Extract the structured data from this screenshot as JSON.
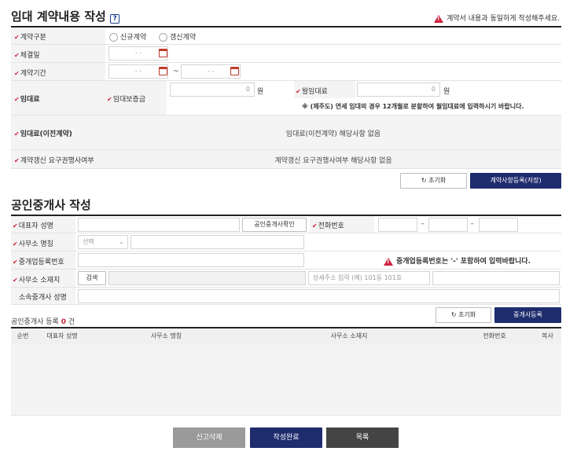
{
  "section1": {
    "title": "임대 계약내용 작성",
    "help_icon": "?",
    "warning": "계약서 내용과 동일하게 작성해주세요.",
    "contract_type": {
      "label": "계약구분",
      "options": [
        "신규계약",
        "갱신계약"
      ]
    },
    "sign_date": {
      "label": "체결일",
      "placeholder": "- -"
    },
    "period": {
      "label": "계약기간",
      "from_placeholder": "- -",
      "tilde": "~",
      "to_placeholder": "- -"
    },
    "rent": {
      "label": "임대료",
      "deposit_label": "임대보증금",
      "deposit_value": "0",
      "deposit_unit": "원",
      "monthly_label": "월임대료",
      "monthly_value": "0",
      "monthly_unit": "원",
      "note": "※ (제주도) 연세 임대의 경우 12개월로 분할하여 월임대료에 입력하시기 바랍니다."
    },
    "prev_rent": {
      "label": "임대료(이전계약)",
      "value": "임대료(이전계약) 해당사항 없음"
    },
    "renewal_right": {
      "label": "계약갱신 요구권행사여부",
      "value": "계약갱신 요구권행사여부 해당사항 없음"
    },
    "reset_button": "초기화",
    "save_button": "계약사항등록(저장)"
  },
  "section2": {
    "title": "공인중개사 작성",
    "rep_name_label": "대표자 성명",
    "verify_button": "공인중개사확인",
    "phone_label": "전화번호",
    "phone_dash": "-",
    "office_name_label": "사무소 명칭",
    "office_select": "선택",
    "reg_no_label": "중개업등록번호",
    "reg_warning": "중개업등록번호는 '-' 포함하여 입력바랍니다.",
    "address_label": "사무소 소재지",
    "search_button": "검색",
    "detail_placeholder": "상세주소 입력 (예) 101동 101호",
    "agent_name_label": "소속중개사 성명",
    "count_prefix": "공인중개사 등록",
    "count_value": "0",
    "count_suffix": "건",
    "reset_button": "초기화",
    "register_button": "중개사등록",
    "table_headers": [
      "순번",
      "대표자 성명",
      "사무소 명칭",
      "사무소 소재지",
      "전화번호",
      "복사"
    ]
  },
  "footer": {
    "delete_button": "신고삭제",
    "complete_button": "작성완료",
    "list_button": "목록"
  },
  "colors": {
    "navy": "#1f2c6e",
    "required": "#d0213b"
  }
}
